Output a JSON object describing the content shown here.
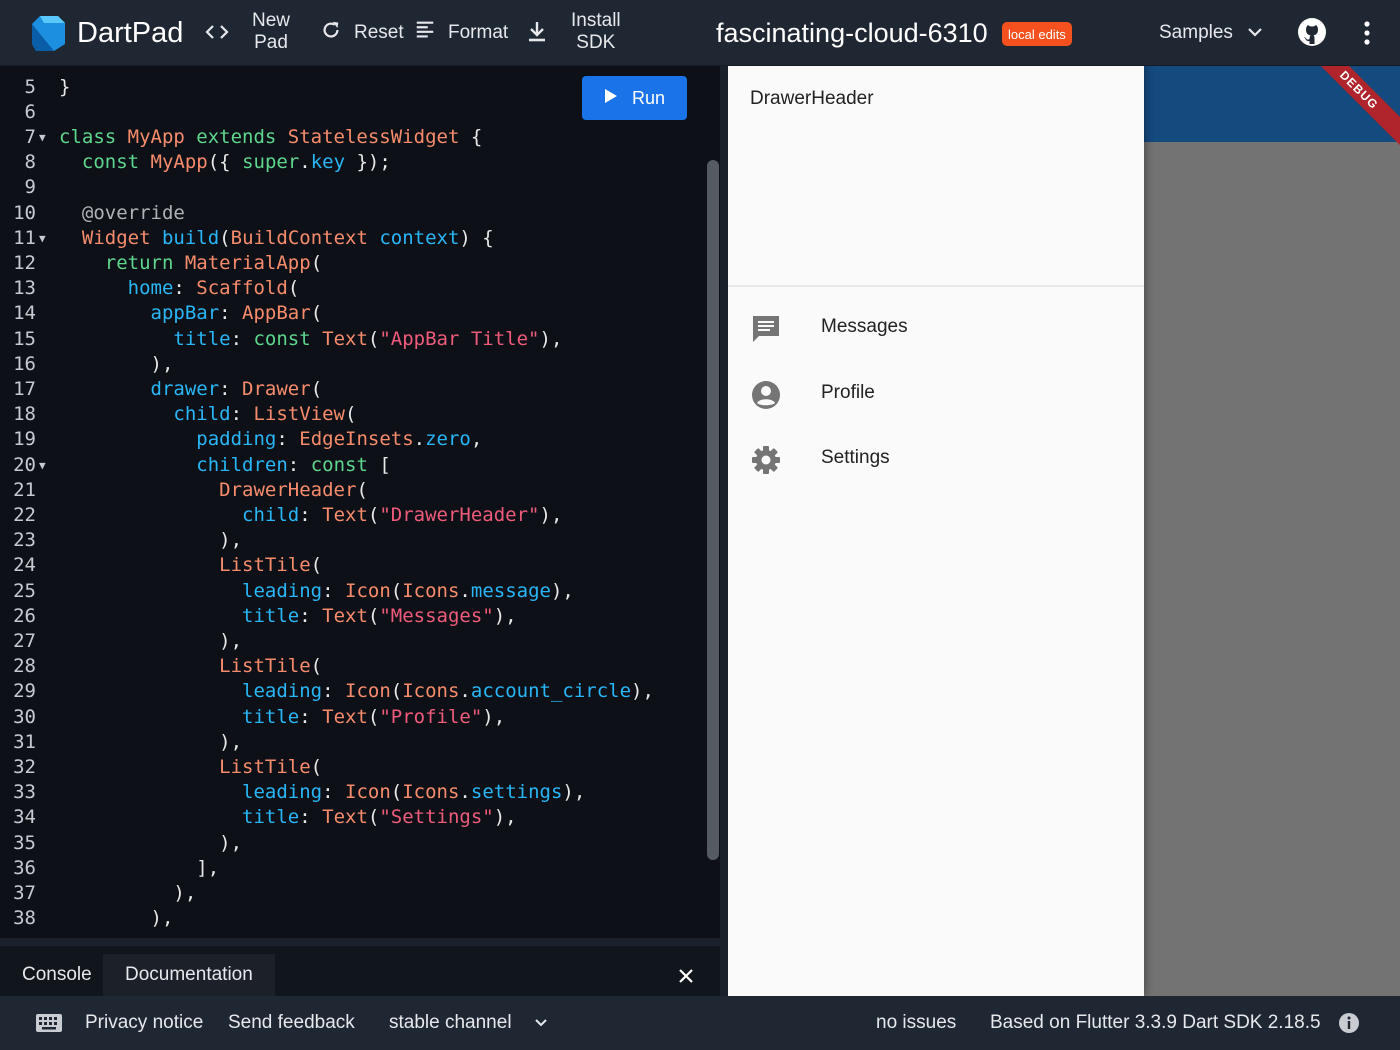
{
  "topbar": {
    "app_name": "DartPad",
    "new_pad": [
      "New",
      "Pad"
    ],
    "reset": "Reset",
    "format": "Format",
    "install_sdk": [
      "Install",
      "SDK"
    ],
    "title": "fascinating-cloud-6310",
    "badge": "local edits",
    "samples": "Samples"
  },
  "editor": {
    "run_label": "Run",
    "lines": [
      {
        "n": "5",
        "fold": false,
        "tokens": [
          [
            "p",
            "}"
          ]
        ]
      },
      {
        "n": "6",
        "fold": false,
        "tokens": []
      },
      {
        "n": "7",
        "fold": true,
        "tokens": [
          [
            "kw",
            "class "
          ],
          [
            "type",
            "MyApp "
          ],
          [
            "kw",
            "extends "
          ],
          [
            "type",
            "StatelessWidget "
          ],
          [
            "p",
            "{"
          ]
        ]
      },
      {
        "n": "8",
        "fold": false,
        "tokens": [
          [
            "p",
            "  "
          ],
          [
            "kw",
            "const "
          ],
          [
            "type",
            "MyApp"
          ],
          [
            "p",
            "({ "
          ],
          [
            "kw",
            "super"
          ],
          [
            "p",
            "."
          ],
          [
            "prop",
            "key"
          ],
          [
            "p",
            " });"
          ]
        ]
      },
      {
        "n": "9",
        "fold": false,
        "tokens": []
      },
      {
        "n": "10",
        "fold": false,
        "tokens": [
          [
            "anno",
            "  @override"
          ]
        ]
      },
      {
        "n": "11",
        "fold": true,
        "tokens": [
          [
            "p",
            "  "
          ],
          [
            "type",
            "Widget "
          ],
          [
            "prop",
            "build"
          ],
          [
            "p",
            "("
          ],
          [
            "type",
            "BuildContext "
          ],
          [
            "prop",
            "context"
          ],
          [
            "p",
            ") {"
          ]
        ]
      },
      {
        "n": "12",
        "fold": false,
        "tokens": [
          [
            "p",
            "    "
          ],
          [
            "kw",
            "return "
          ],
          [
            "type",
            "MaterialApp"
          ],
          [
            "p",
            "("
          ]
        ]
      },
      {
        "n": "13",
        "fold": false,
        "tokens": [
          [
            "p",
            "      "
          ],
          [
            "prop",
            "home"
          ],
          [
            "p",
            ": "
          ],
          [
            "type",
            "Scaffold"
          ],
          [
            "p",
            "("
          ]
        ]
      },
      {
        "n": "14",
        "fold": false,
        "tokens": [
          [
            "p",
            "        "
          ],
          [
            "prop",
            "appBar"
          ],
          [
            "p",
            ": "
          ],
          [
            "type",
            "AppBar"
          ],
          [
            "p",
            "("
          ]
        ]
      },
      {
        "n": "15",
        "fold": false,
        "tokens": [
          [
            "p",
            "          "
          ],
          [
            "prop",
            "title"
          ],
          [
            "p",
            ": "
          ],
          [
            "kw",
            "const "
          ],
          [
            "type",
            "Text"
          ],
          [
            "p",
            "("
          ],
          [
            "str",
            "\"AppBar Title\""
          ],
          [
            "p",
            "),"
          ]
        ]
      },
      {
        "n": "16",
        "fold": false,
        "tokens": [
          [
            "p",
            "        ),"
          ]
        ]
      },
      {
        "n": "17",
        "fold": false,
        "tokens": [
          [
            "p",
            "        "
          ],
          [
            "prop",
            "drawer"
          ],
          [
            "p",
            ": "
          ],
          [
            "type",
            "Drawer"
          ],
          [
            "p",
            "("
          ]
        ]
      },
      {
        "n": "18",
        "fold": false,
        "tokens": [
          [
            "p",
            "          "
          ],
          [
            "prop",
            "child"
          ],
          [
            "p",
            ": "
          ],
          [
            "type",
            "ListView"
          ],
          [
            "p",
            "("
          ]
        ]
      },
      {
        "n": "19",
        "fold": false,
        "tokens": [
          [
            "p",
            "            "
          ],
          [
            "prop",
            "padding"
          ],
          [
            "p",
            ": "
          ],
          [
            "type",
            "EdgeInsets"
          ],
          [
            "p",
            "."
          ],
          [
            "prop",
            "zero"
          ],
          [
            "p",
            ","
          ]
        ]
      },
      {
        "n": "20",
        "fold": true,
        "tokens": [
          [
            "p",
            "            "
          ],
          [
            "prop",
            "children"
          ],
          [
            "p",
            ": "
          ],
          [
            "kw",
            "const "
          ],
          [
            "p",
            "["
          ]
        ]
      },
      {
        "n": "21",
        "fold": false,
        "tokens": [
          [
            "p",
            "              "
          ],
          [
            "type",
            "DrawerHeader"
          ],
          [
            "p",
            "("
          ]
        ]
      },
      {
        "n": "22",
        "fold": false,
        "tokens": [
          [
            "p",
            "                "
          ],
          [
            "prop",
            "child"
          ],
          [
            "p",
            ": "
          ],
          [
            "type",
            "Text"
          ],
          [
            "p",
            "("
          ],
          [
            "str",
            "\"DrawerHeader\""
          ],
          [
            "p",
            "),"
          ]
        ]
      },
      {
        "n": "23",
        "fold": false,
        "tokens": [
          [
            "p",
            "              ),"
          ]
        ]
      },
      {
        "n": "24",
        "fold": false,
        "tokens": [
          [
            "p",
            "              "
          ],
          [
            "type",
            "ListTile"
          ],
          [
            "p",
            "("
          ]
        ]
      },
      {
        "n": "25",
        "fold": false,
        "tokens": [
          [
            "p",
            "                "
          ],
          [
            "prop",
            "leading"
          ],
          [
            "p",
            ": "
          ],
          [
            "type",
            "Icon"
          ],
          [
            "p",
            "("
          ],
          [
            "type",
            "Icons"
          ],
          [
            "p",
            "."
          ],
          [
            "prop",
            "message"
          ],
          [
            "p",
            "),"
          ]
        ]
      },
      {
        "n": "26",
        "fold": false,
        "tokens": [
          [
            "p",
            "                "
          ],
          [
            "prop",
            "title"
          ],
          [
            "p",
            ": "
          ],
          [
            "type",
            "Text"
          ],
          [
            "p",
            "("
          ],
          [
            "str",
            "\"Messages\""
          ],
          [
            "p",
            "),"
          ]
        ]
      },
      {
        "n": "27",
        "fold": false,
        "tokens": [
          [
            "p",
            "              ),"
          ]
        ]
      },
      {
        "n": "28",
        "fold": false,
        "tokens": [
          [
            "p",
            "              "
          ],
          [
            "type",
            "ListTile"
          ],
          [
            "p",
            "("
          ]
        ]
      },
      {
        "n": "29",
        "fold": false,
        "tokens": [
          [
            "p",
            "                "
          ],
          [
            "prop",
            "leading"
          ],
          [
            "p",
            ": "
          ],
          [
            "type",
            "Icon"
          ],
          [
            "p",
            "("
          ],
          [
            "type",
            "Icons"
          ],
          [
            "p",
            "."
          ],
          [
            "prop",
            "account_circle"
          ],
          [
            "p",
            "),"
          ]
        ]
      },
      {
        "n": "30",
        "fold": false,
        "tokens": [
          [
            "p",
            "                "
          ],
          [
            "prop",
            "title"
          ],
          [
            "p",
            ": "
          ],
          [
            "type",
            "Text"
          ],
          [
            "p",
            "("
          ],
          [
            "str",
            "\"Profile\""
          ],
          [
            "p",
            "),"
          ]
        ]
      },
      {
        "n": "31",
        "fold": false,
        "tokens": [
          [
            "p",
            "              ),"
          ]
        ]
      },
      {
        "n": "32",
        "fold": false,
        "tokens": [
          [
            "p",
            "              "
          ],
          [
            "type",
            "ListTile"
          ],
          [
            "p",
            "("
          ]
        ]
      },
      {
        "n": "33",
        "fold": false,
        "tokens": [
          [
            "p",
            "                "
          ],
          [
            "prop",
            "leading"
          ],
          [
            "p",
            ": "
          ],
          [
            "type",
            "Icon"
          ],
          [
            "p",
            "("
          ],
          [
            "type",
            "Icons"
          ],
          [
            "p",
            "."
          ],
          [
            "prop",
            "settings"
          ],
          [
            "p",
            "),"
          ]
        ]
      },
      {
        "n": "34",
        "fold": false,
        "tokens": [
          [
            "p",
            "                "
          ],
          [
            "prop",
            "title"
          ],
          [
            "p",
            ": "
          ],
          [
            "type",
            "Text"
          ],
          [
            "p",
            "("
          ],
          [
            "str",
            "\"Settings\""
          ],
          [
            "p",
            "),"
          ]
        ]
      },
      {
        "n": "35",
        "fold": false,
        "tokens": [
          [
            "p",
            "              ),"
          ]
        ]
      },
      {
        "n": "36",
        "fold": false,
        "tokens": [
          [
            "p",
            "            ],"
          ]
        ]
      },
      {
        "n": "37",
        "fold": false,
        "tokens": [
          [
            "p",
            "          ),"
          ]
        ]
      },
      {
        "n": "38",
        "fold": false,
        "tokens": [
          [
            "p",
            "        ),"
          ]
        ]
      }
    ]
  },
  "console": {
    "tabs": [
      "Console",
      "Documentation"
    ]
  },
  "preview": {
    "drawer_header": "DrawerHeader",
    "tiles": [
      {
        "label": "Messages",
        "icon": "message-icon"
      },
      {
        "label": "Profile",
        "icon": "account-circle-icon"
      },
      {
        "label": "Settings",
        "icon": "settings-icon"
      }
    ],
    "debug_banner": "DEBUG",
    "colors": {
      "appbar": "#154a7f",
      "scrim": "#737373",
      "drawer": "#fafafa"
    }
  },
  "statusbar": {
    "privacy": "Privacy notice",
    "feedback": "Send feedback",
    "channel": "stable channel",
    "issues": "no issues",
    "version": "Based on Flutter 3.3.9 Dart SDK 2.18.5"
  },
  "colors": {
    "accent": "#1a73e8",
    "badge": "#f4511e",
    "topbar": "#1f2733",
    "editor_bg": "#0d1117"
  }
}
